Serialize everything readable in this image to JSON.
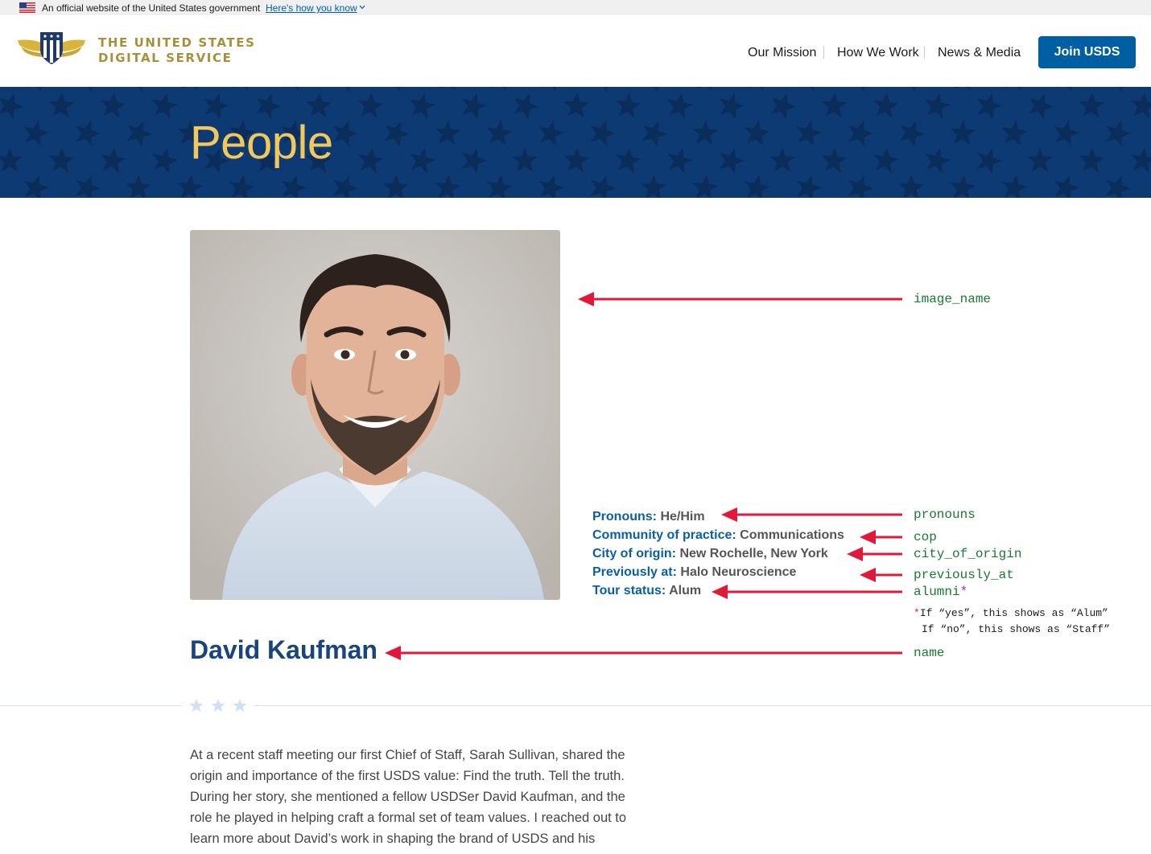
{
  "gov_banner": {
    "text": "An official website of the United States government",
    "link": "Here's how you know",
    "icons": [
      "us-flag-icon",
      "chevron-down-icon"
    ]
  },
  "header": {
    "logo_line1": "THE UNITED STATES",
    "logo_line2": "DIGITAL SERVICE",
    "nav": [
      "Our Mission",
      "How We Work",
      "News & Media"
    ],
    "cta": "Join USDS",
    "colors": {
      "logo_gold": "#a8903a",
      "cta_blue": "#005ea2"
    }
  },
  "hero": {
    "title": "People",
    "colors": {
      "background": "#0e3a73",
      "title": "#f2c85b"
    }
  },
  "profile": {
    "photo_icon": "headshot-photo",
    "details": [
      {
        "label": "Pronouns:",
        "value": "He/Him"
      },
      {
        "label": "Community of practice:",
        "value": "Communications"
      },
      {
        "label": "City of origin:",
        "value": "New Rochelle, New York"
      },
      {
        "label": "Previously at:",
        "value": "Halo Neuroscience"
      },
      {
        "label": "Tour status:",
        "value": "Alum"
      }
    ],
    "name": "David Kaufman"
  },
  "annotations": {
    "image": "image_name",
    "pronouns": "pronouns",
    "cop": "cop",
    "city": "city_of_origin",
    "previously": "previously_at",
    "alumni": "alumni",
    "alumni_star": "*",
    "note_star": "*",
    "note_line1": "If “yes”, this shows as “Alum”",
    "note_line2": "If “no”, this shows as “Staff”",
    "name": "name",
    "colors": {
      "arrow": "#e0193a",
      "code": "#1a7a2e",
      "asterisk": "#c21aa8"
    }
  },
  "body": {
    "paragraph": "At a recent staff meeting our first Chief of Staff, Sarah Sullivan, shared the origin and importance of the first USDS value: Find the truth. Tell the truth. During her story, she mentioned a fellow USDSer David Kaufman, and the role he played in helping craft a formal set of team values. I reached out to learn more about David’s work in shaping the brand of USDS and his experience"
  }
}
